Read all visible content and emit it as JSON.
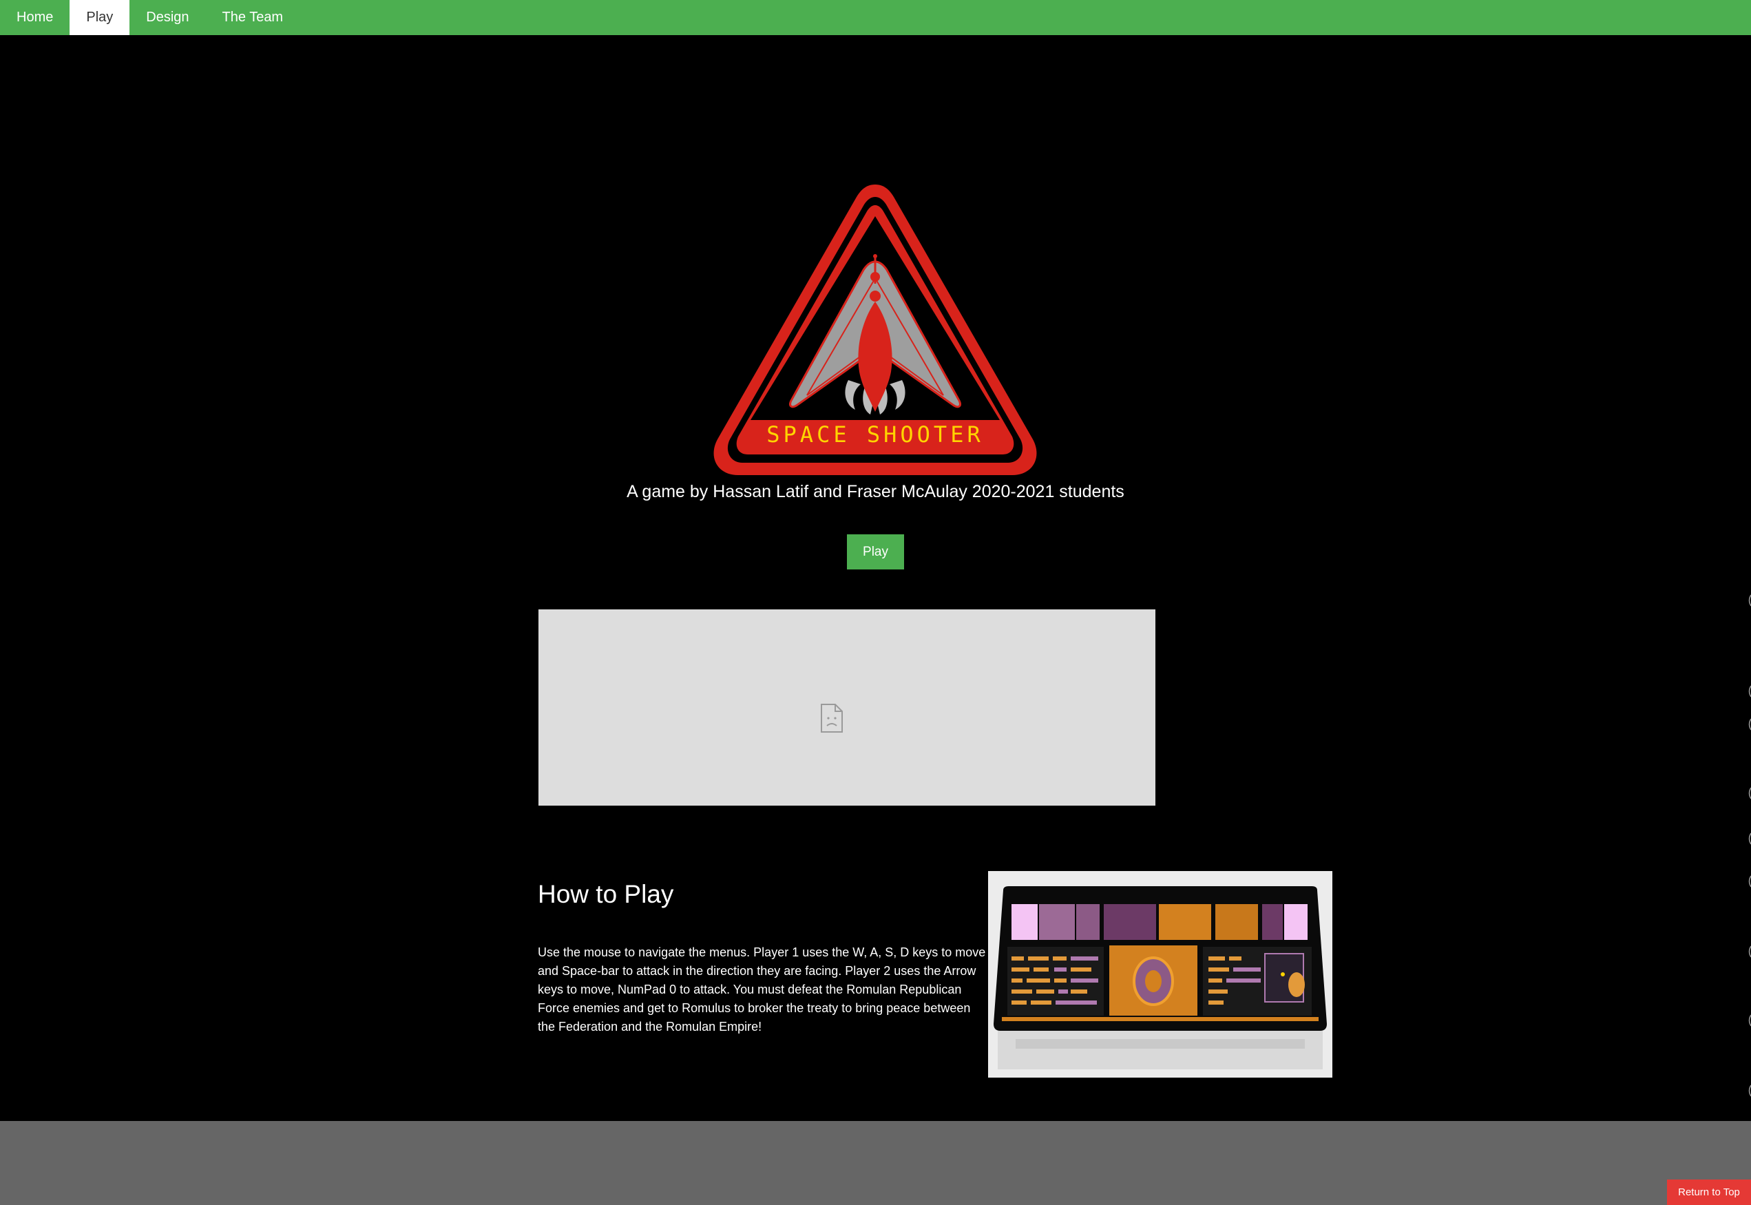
{
  "nav": {
    "items": [
      {
        "label": "Home",
        "active": false
      },
      {
        "label": "Play",
        "active": true
      },
      {
        "label": "Design",
        "active": false
      },
      {
        "label": "The Team",
        "active": false
      }
    ]
  },
  "hero": {
    "logo_text": "SPACE SHOOTER",
    "subtitle": "A game by Hassan Latif and Fraser McAulay 2020-2021 students",
    "play_label": "Play"
  },
  "embed": {
    "icon": "broken-document-icon"
  },
  "how_to_play": {
    "title": "How to Play",
    "text": "Use the mouse to navigate the menus. Player 1 uses the W, A, S, D keys to move and Space-bar to attack in the direction they are facing. Player 2 uses the Arrow keys to move, NumPad 0 to attack. You must defeat the Romulan Republican Force enemies and get to Romulus to broker the treaty to bring peace between the Federation and the Romulan Empire!"
  },
  "footer": {
    "return_top_label": "Return to Top"
  },
  "colors": {
    "nav_bg": "#4caf50",
    "accent_red": "#e53935",
    "logo_red": "#d8231b",
    "logo_yellow": "#ffd400",
    "footer_bg": "#666666"
  }
}
